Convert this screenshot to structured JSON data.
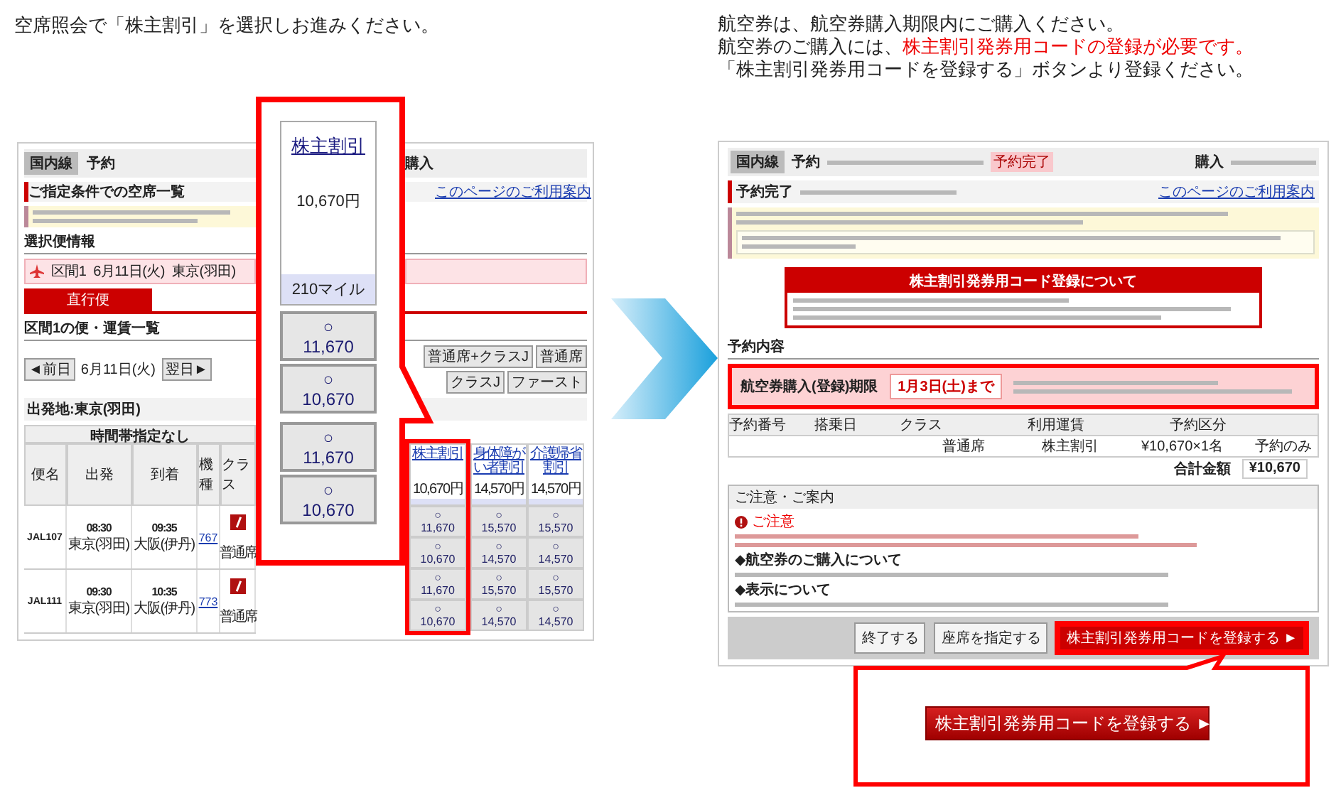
{
  "left_panel": {
    "instruction": "空席照会で「株主割引」を選択しお進みください。",
    "screenshot": {
      "nav": {
        "section": "国内線",
        "step": "予約",
        "purchase": "購入"
      },
      "title": "ご指定条件での空席一覧",
      "help_link": "このページのご利用案内",
      "selected_flight_heading": "選択便情報",
      "selected_flight": {
        "segment": "区間1",
        "date": "6月11日(火)",
        "origin": "東京(羽田)"
      },
      "tab": "直行便",
      "list_heading": "区間1の便・運賃一覧",
      "date_nav": {
        "prev": "◄前日",
        "date": "6月11日(火)",
        "next": "翌日►"
      },
      "class_buttons": [
        "普通席+クラスJ",
        "普通席",
        "クラスJ",
        "ファースト"
      ],
      "departure": "出発地:東京(羽田)",
      "table": {
        "time_header": "時間帯指定なし",
        "columns": [
          "便名",
          "出発",
          "到着",
          "機種",
          "クラス"
        ],
        "fare_columns": [
          {
            "name": "株主割引",
            "price": "10,670円",
            "highlighted": true
          },
          {
            "name": "身体障がい者割引",
            "price": "14,570円",
            "highlighted": false
          },
          {
            "name": "介護帰省割引",
            "price": "14,570円",
            "highlighted": false
          }
        ],
        "rows": [
          {
            "flight": "JAL107",
            "dep_time": "08:30",
            "dep_airport": "東京(羽田)",
            "arr_time": "09:35",
            "arr_airport": "大阪(伊丹)",
            "aircraft": "767",
            "classes": [
              {
                "kind": "classj",
                "fares": [
                  {
                    "mark": "○",
                    "price": "11,670"
                  },
                  {
                    "mark": "○",
                    "price": "15,570"
                  },
                  {
                    "mark": "○",
                    "price": "15,570"
                  }
                ]
              },
              {
                "kind": "economy",
                "label": "普通席",
                "fares": [
                  {
                    "mark": "○",
                    "price": "10,670"
                  },
                  {
                    "mark": "○",
                    "price": "14,570"
                  },
                  {
                    "mark": "○",
                    "price": "14,570"
                  }
                ]
              }
            ]
          },
          {
            "flight": "JAL111",
            "dep_time": "09:30",
            "dep_airport": "東京(羽田)",
            "arr_time": "10:35",
            "arr_airport": "大阪(伊丹)",
            "aircraft": "773",
            "classes": [
              {
                "kind": "classj",
                "fares": [
                  {
                    "mark": "○",
                    "price": "11,670"
                  },
                  {
                    "mark": "○",
                    "price": "15,570"
                  },
                  {
                    "mark": "○",
                    "price": "15,570"
                  }
                ]
              },
              {
                "kind": "economy",
                "label": "普通席",
                "fares": [
                  {
                    "mark": "○",
                    "price": "10,670"
                  },
                  {
                    "mark": "○",
                    "price": "14,570"
                  },
                  {
                    "mark": "○",
                    "price": "14,570"
                  }
                ]
              }
            ]
          }
        ]
      }
    },
    "callout": {
      "fare_name": "株主割引",
      "price": "10,670円",
      "miles": "210マイル",
      "options": [
        {
          "mark": "○",
          "price": "11,670"
        },
        {
          "mark": "○",
          "price": "10,670"
        },
        {
          "mark": "○",
          "price": "11,670"
        },
        {
          "mark": "○",
          "price": "10,670"
        }
      ]
    }
  },
  "right_panel": {
    "instructions": [
      {
        "text": "航空券は、航空券購入期限内にご購入ください。"
      },
      {
        "text": "航空券のご購入には、",
        "emphasis": "株主割引発券用コードの登録が必要です。"
      },
      {
        "text": "「株主割引発券用コードを登録する」ボタンより登録ください。"
      }
    ],
    "screenshot": {
      "nav": {
        "section": "国内線",
        "step": "予約",
        "current_step": "予約完了",
        "purchase": "購入"
      },
      "title": "予約完了",
      "help_link": "このページのご利用案内",
      "info_box": {
        "title": "株主割引発券用コード登録について"
      },
      "reservation_heading": "予約内容",
      "deadline": {
        "label": "航空券購入(登録)期限",
        "date": "1月3日(土)まで"
      },
      "table": {
        "headers": [
          "予約番号",
          "搭乗日",
          "クラス",
          "利用運賃",
          "予約区分"
        ],
        "row": {
          "class": "普通席",
          "fare": "株主割引",
          "amount": "¥10,670×1名",
          "booking_type": "予約のみ"
        }
      },
      "total": {
        "label": "合計金額",
        "amount": "¥10,670"
      },
      "notes": {
        "title": "ご注意・ご案内",
        "caution": "ご注意",
        "sections": [
          "◆航空券のご購入について",
          "◆表示について"
        ]
      },
      "buttons": [
        {
          "label": "終了する",
          "kind": "plain",
          "highlighted": false
        },
        {
          "label": "座席を指定する",
          "kind": "plain",
          "highlighted": false
        },
        {
          "label": "株主割引発券用コードを登録する ►",
          "kind": "primary",
          "highlighted": true
        }
      ]
    },
    "callout": {
      "button": "株主割引発券用コードを登録する ►"
    }
  }
}
